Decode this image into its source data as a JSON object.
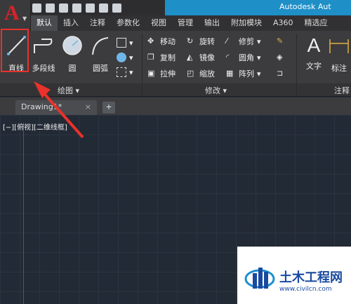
{
  "app": {
    "title": "Autodesk Aut"
  },
  "ribbon_tabs": [
    "默认",
    "插入",
    "注释",
    "参数化",
    "视图",
    "管理",
    "输出",
    "附加模块",
    "A360",
    "精选应"
  ],
  "draw_panel": {
    "line": "直线",
    "polyline": "多段线",
    "circle": "圆",
    "arc": "圆弧",
    "label": "绘图 ▾"
  },
  "modify_panel": {
    "move": "移动",
    "rotate": "旋转",
    "trim": "修剪",
    "copy": "复制",
    "mirror": "镜像",
    "fillet": "圆角",
    "stretch": "拉伸",
    "scale": "缩放",
    "array": "阵列",
    "label": "修改 ▾"
  },
  "annotation_panel": {
    "text": "文字",
    "dimension": "标注",
    "label": "注释"
  },
  "file_tab": {
    "name": "Drawing1*",
    "close": "×",
    "new": "+"
  },
  "viewport_label": "[−][俯视][二维线框]",
  "watermark": {
    "brand": "土木工程网",
    "url": "www.civilcn.com"
  },
  "colors": {
    "accent": "#1e8fc7",
    "highlight": "#e8322b",
    "canvas": "#222a35"
  }
}
